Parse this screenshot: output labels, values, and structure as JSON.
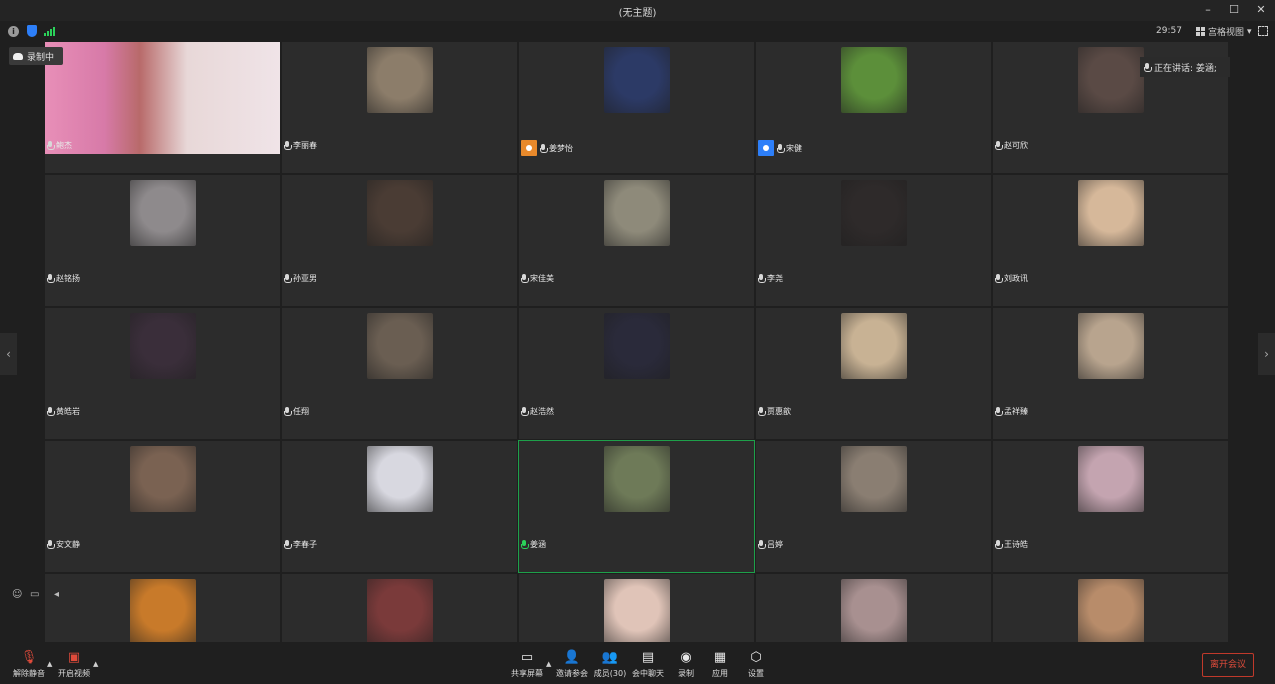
{
  "window": {
    "title": "(无主题)"
  },
  "info_bar": {
    "timer": "29:57",
    "view_label": "宫格视图",
    "view_caret": "▾"
  },
  "recording": {
    "label": "录制中"
  },
  "speaker": {
    "label": "正在讲话: 姜涵;"
  },
  "participants": [
    {
      "name": "鲍杰",
      "host": "",
      "color": "#c48ea6",
      "video": true
    },
    {
      "name": "李丽春",
      "host": "",
      "color": "#8c7d6a"
    },
    {
      "name": "姜梦怡",
      "host": "orange",
      "color": "#2c3a66"
    },
    {
      "name": "宋健",
      "host": "blue",
      "color": "#5c8f3a"
    },
    {
      "name": "赵可欣",
      "host": "",
      "color": "#5a4a45"
    },
    {
      "name": "赵铭扬",
      "host": "",
      "color": "#8e8a8c"
    },
    {
      "name": "孙亚男",
      "host": "",
      "color": "#4a3c34"
    },
    {
      "name": "宋佳美",
      "host": "",
      "color": "#8e8a7a"
    },
    {
      "name": "李尧",
      "host": "",
      "color": "#2e2a2a"
    },
    {
      "name": "刘政讯",
      "host": "",
      "color": "#d6b89a"
    },
    {
      "name": "黄皓岩",
      "host": "",
      "color": "#3a2e3a"
    },
    {
      "name": "任翔",
      "host": "",
      "color": "#6a5e52"
    },
    {
      "name": "赵浩然",
      "host": "",
      "color": "#2a2a3a"
    },
    {
      "name": "贾惠歆",
      "host": "",
      "color": "#c8b294"
    },
    {
      "name": "孟祥臻",
      "host": "",
      "color": "#b8a48e"
    },
    {
      "name": "安文静",
      "host": "",
      "color": "#7a6252"
    },
    {
      "name": "李春子",
      "host": "",
      "color": "#d8d8e0"
    },
    {
      "name": "姜涵",
      "host": "",
      "color": "#6e7a58",
      "active": true
    },
    {
      "name": "吕婷",
      "host": "",
      "color": "#8a7e72"
    },
    {
      "name": "王诗皓",
      "host": "",
      "color": "#c4a4b0"
    },
    {
      "name": "",
      "host": "",
      "color": "#c87a2a"
    },
    {
      "name": "",
      "host": "",
      "color": "#7a3a3a"
    },
    {
      "name": "",
      "host": "",
      "color": "#e0c4b8"
    },
    {
      "name": "",
      "host": "",
      "color": "#a89090"
    },
    {
      "name": "",
      "host": "",
      "color": "#b88c6a"
    }
  ],
  "toolbar": {
    "unmute": "解除静音",
    "start_video": "开启视频",
    "share_screen": "共享屏幕",
    "invite": "邀请参会",
    "members": "成员(30)",
    "chat": "会中聊天",
    "record": "录制",
    "apps": "应用",
    "settings": "设置",
    "leave": "离开会议"
  },
  "icons": [
    "info-icon",
    "shield-icon",
    "signal-icon",
    "grid-view-icon",
    "fullscreen-icon",
    "mic-icon",
    "camera-off-icon",
    "share-screen-icon",
    "invite-icon",
    "members-icon",
    "chat-icon",
    "record-icon",
    "apps-icon",
    "settings-icon"
  ]
}
